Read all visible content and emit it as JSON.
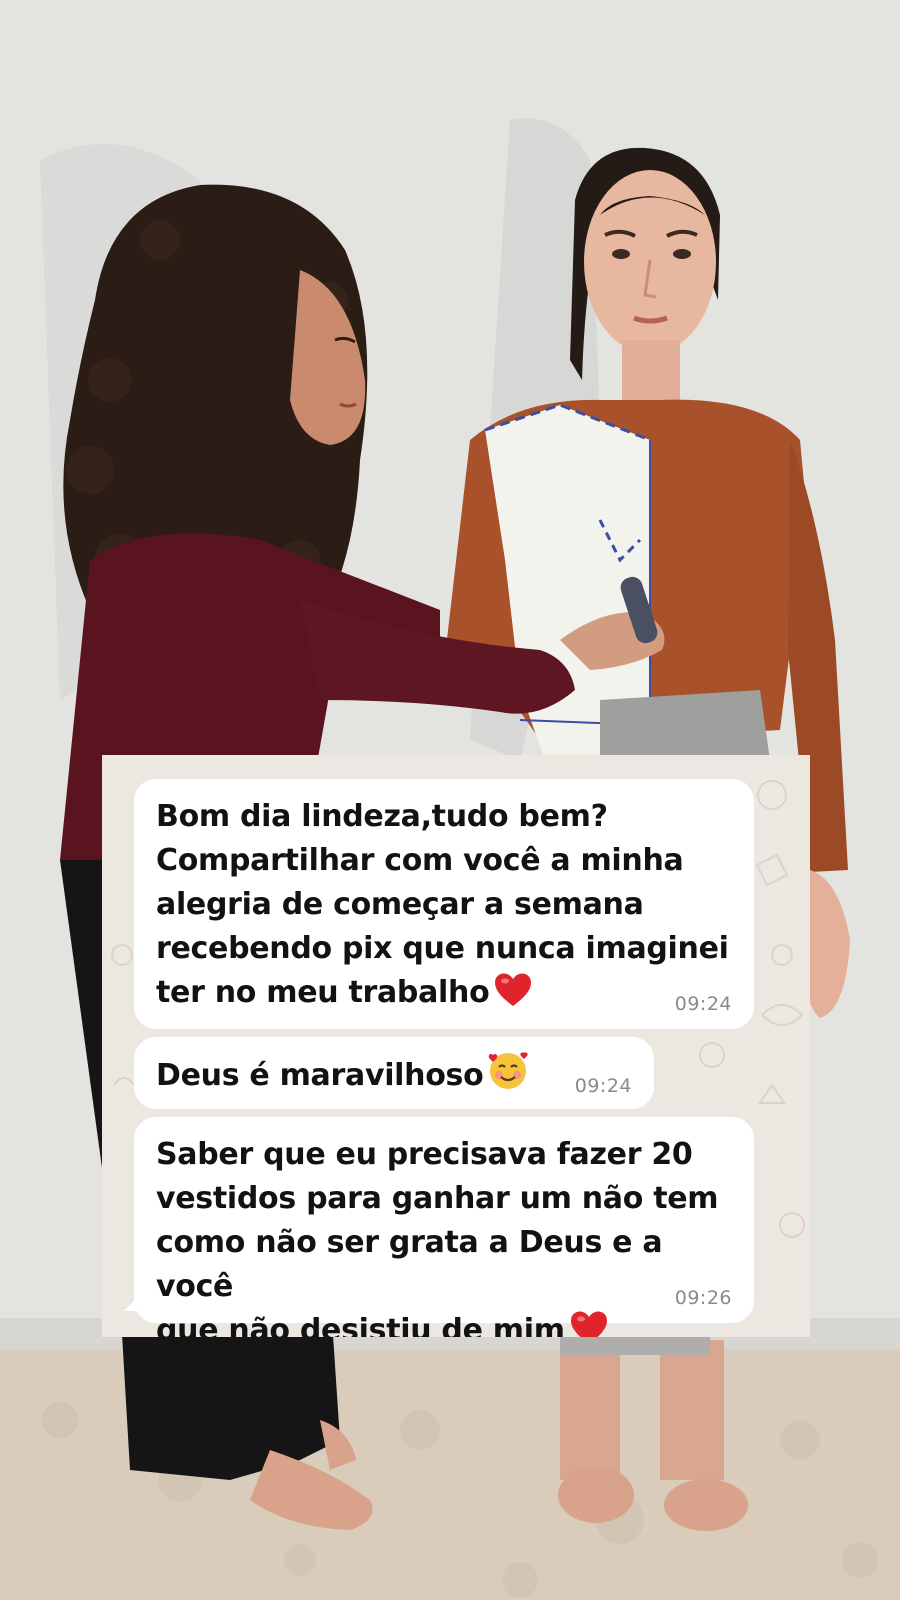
{
  "messages": [
    {
      "text": "Bom dia lindeza,tudo bem?\nCompartilhar com você a minha\nalegria de começar a semana\nrecebendo pix que nunca imaginei\nter no meu trabalho",
      "emoji": "red-heart-icon",
      "time": "09:24"
    },
    {
      "text": "Deus é maravilhoso",
      "emoji": "smiling-face-with-hearts-icon",
      "time": "09:24"
    },
    {
      "text": "Saber que eu precisava fazer 20\nvestidos para ganhar um não tem\ncomo não ser grata a Deus e a você\nque não desistiu de mim",
      "emoji": "red-heart-icon",
      "time": "09:26"
    }
  ],
  "colors": {
    "chat_background": "#ece7e1",
    "bubble": "#ffffff",
    "timestamp": "#8a8a8a",
    "rust_top": "#a8512a",
    "burgundy_sweater": "#5a1420",
    "wall": "#e7e7e5",
    "carpet": "#d9ccbb"
  }
}
